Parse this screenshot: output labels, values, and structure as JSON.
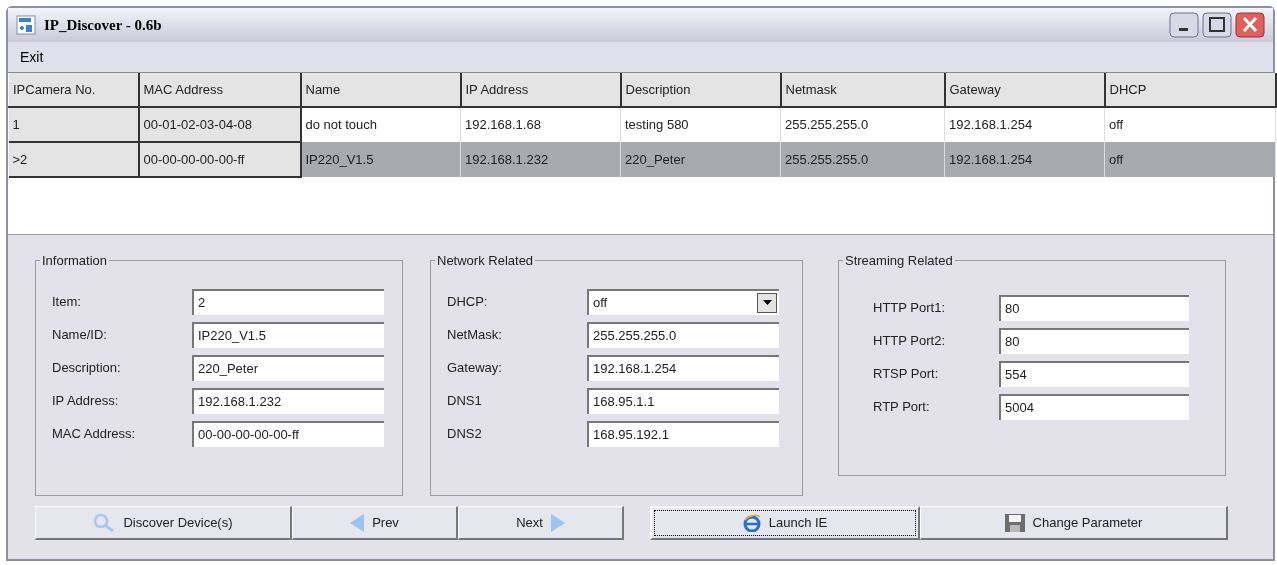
{
  "window": {
    "title": "IP_Discover - 0.6b"
  },
  "menu": [
    "Exit"
  ],
  "table": {
    "columns": [
      "IPCamera No.",
      "MAC Address",
      "Name",
      "IP Address",
      "Description",
      "Netmask",
      "Gateway",
      "DHCP"
    ],
    "rows": [
      {
        "selected": false,
        "cells": [
          "1",
          "00-01-02-03-04-08",
          "do not touch",
          "192.168.1.68",
          "testing 580",
          "255.255.255.0",
          "192.168.1.254",
          "off"
        ]
      },
      {
        "selected": true,
        "cells": [
          ">2",
          "00-00-00-00-00-ff",
          "IP220_V1.5",
          "192.168.1.232",
          "220_Peter",
          "255.255.255.0",
          "192.168.1.254",
          "off"
        ]
      }
    ]
  },
  "groups": [
    {
      "title": "Information",
      "fields": [
        {
          "kind": "text",
          "label": "Item:",
          "value": "2"
        },
        {
          "kind": "text",
          "label": "Name/ID:",
          "value": "IP220_V1.5"
        },
        {
          "kind": "text",
          "label": "Description:",
          "value": "220_Peter"
        },
        {
          "kind": "text",
          "label": "IP Address:",
          "value": "192.168.1.232"
        },
        {
          "kind": "text",
          "label": "MAC Address:",
          "value": "00-00-00-00-00-ff"
        }
      ]
    },
    {
      "title": "Network Related",
      "fields": [
        {
          "kind": "dropdown",
          "label": "DHCP:",
          "value": "off"
        },
        {
          "kind": "text",
          "label": "NetMask:",
          "value": "255.255.255.0"
        },
        {
          "kind": "text",
          "label": "Gateway:",
          "value": "192.168.1.254"
        },
        {
          "kind": "text",
          "label": "DNS1",
          "value": "168.95.1.1"
        },
        {
          "kind": "text",
          "label": "DNS2",
          "value": "168.95.192.1"
        }
      ]
    },
    {
      "title": "Streaming Related",
      "fields": [
        {
          "kind": "text",
          "label": "HTTP Port1:",
          "value": "80"
        },
        {
          "kind": "text",
          "label": "HTTP Port2:",
          "value": "80"
        },
        {
          "kind": "text",
          "label": "RTSP Port:",
          "value": "554"
        },
        {
          "kind": "text",
          "label": "RTP Port:",
          "value": "5004"
        }
      ]
    }
  ],
  "buttons": [
    {
      "label": "Discover Device(s)",
      "kind": "search",
      "focused": false
    },
    {
      "label": "Prev",
      "kind": "back",
      "focused": false
    },
    {
      "label": "Next",
      "kind": "forward",
      "focused": false
    },
    {
      "label": "Launch IE",
      "kind": "browser",
      "focused": true
    },
    {
      "label": "Change Parameter",
      "kind": "save",
      "focused": false
    }
  ]
}
